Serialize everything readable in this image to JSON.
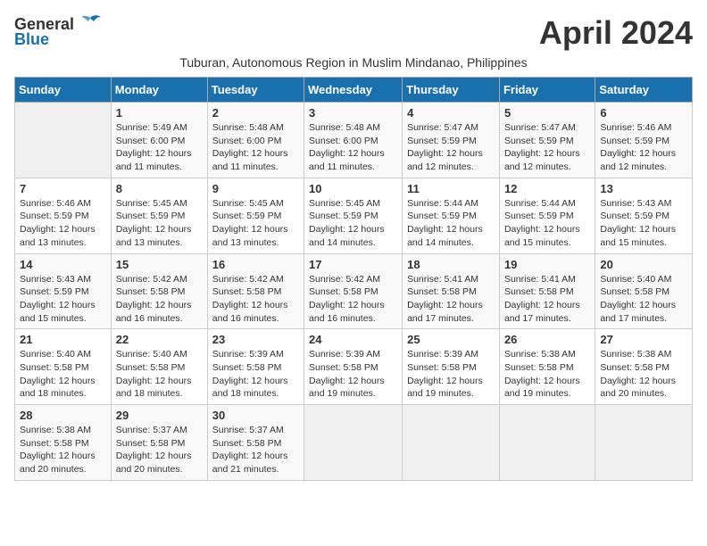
{
  "header": {
    "logo_general": "General",
    "logo_blue": "Blue",
    "title": "April 2024",
    "subtitle": "Tuburan, Autonomous Region in Muslim Mindanao, Philippines"
  },
  "columns": [
    "Sunday",
    "Monday",
    "Tuesday",
    "Wednesday",
    "Thursday",
    "Friday",
    "Saturday"
  ],
  "weeks": [
    [
      {
        "day": "",
        "info": ""
      },
      {
        "day": "1",
        "info": "Sunrise: 5:49 AM\nSunset: 6:00 PM\nDaylight: 12 hours\nand 11 minutes."
      },
      {
        "day": "2",
        "info": "Sunrise: 5:48 AM\nSunset: 6:00 PM\nDaylight: 12 hours\nand 11 minutes."
      },
      {
        "day": "3",
        "info": "Sunrise: 5:48 AM\nSunset: 6:00 PM\nDaylight: 12 hours\nand 11 minutes."
      },
      {
        "day": "4",
        "info": "Sunrise: 5:47 AM\nSunset: 5:59 PM\nDaylight: 12 hours\nand 12 minutes."
      },
      {
        "day": "5",
        "info": "Sunrise: 5:47 AM\nSunset: 5:59 PM\nDaylight: 12 hours\nand 12 minutes."
      },
      {
        "day": "6",
        "info": "Sunrise: 5:46 AM\nSunset: 5:59 PM\nDaylight: 12 hours\nand 12 minutes."
      }
    ],
    [
      {
        "day": "7",
        "info": "Sunrise: 5:46 AM\nSunset: 5:59 PM\nDaylight: 12 hours\nand 13 minutes."
      },
      {
        "day": "8",
        "info": "Sunrise: 5:45 AM\nSunset: 5:59 PM\nDaylight: 12 hours\nand 13 minutes."
      },
      {
        "day": "9",
        "info": "Sunrise: 5:45 AM\nSunset: 5:59 PM\nDaylight: 12 hours\nand 13 minutes."
      },
      {
        "day": "10",
        "info": "Sunrise: 5:45 AM\nSunset: 5:59 PM\nDaylight: 12 hours\nand 14 minutes."
      },
      {
        "day": "11",
        "info": "Sunrise: 5:44 AM\nSunset: 5:59 PM\nDaylight: 12 hours\nand 14 minutes."
      },
      {
        "day": "12",
        "info": "Sunrise: 5:44 AM\nSunset: 5:59 PM\nDaylight: 12 hours\nand 15 minutes."
      },
      {
        "day": "13",
        "info": "Sunrise: 5:43 AM\nSunset: 5:59 PM\nDaylight: 12 hours\nand 15 minutes."
      }
    ],
    [
      {
        "day": "14",
        "info": "Sunrise: 5:43 AM\nSunset: 5:59 PM\nDaylight: 12 hours\nand 15 minutes."
      },
      {
        "day": "15",
        "info": "Sunrise: 5:42 AM\nSunset: 5:58 PM\nDaylight: 12 hours\nand 16 minutes."
      },
      {
        "day": "16",
        "info": "Sunrise: 5:42 AM\nSunset: 5:58 PM\nDaylight: 12 hours\nand 16 minutes."
      },
      {
        "day": "17",
        "info": "Sunrise: 5:42 AM\nSunset: 5:58 PM\nDaylight: 12 hours\nand 16 minutes."
      },
      {
        "day": "18",
        "info": "Sunrise: 5:41 AM\nSunset: 5:58 PM\nDaylight: 12 hours\nand 17 minutes."
      },
      {
        "day": "19",
        "info": "Sunrise: 5:41 AM\nSunset: 5:58 PM\nDaylight: 12 hours\nand 17 minutes."
      },
      {
        "day": "20",
        "info": "Sunrise: 5:40 AM\nSunset: 5:58 PM\nDaylight: 12 hours\nand 17 minutes."
      }
    ],
    [
      {
        "day": "21",
        "info": "Sunrise: 5:40 AM\nSunset: 5:58 PM\nDaylight: 12 hours\nand 18 minutes."
      },
      {
        "day": "22",
        "info": "Sunrise: 5:40 AM\nSunset: 5:58 PM\nDaylight: 12 hours\nand 18 minutes."
      },
      {
        "day": "23",
        "info": "Sunrise: 5:39 AM\nSunset: 5:58 PM\nDaylight: 12 hours\nand 18 minutes."
      },
      {
        "day": "24",
        "info": "Sunrise: 5:39 AM\nSunset: 5:58 PM\nDaylight: 12 hours\nand 19 minutes."
      },
      {
        "day": "25",
        "info": "Sunrise: 5:39 AM\nSunset: 5:58 PM\nDaylight: 12 hours\nand 19 minutes."
      },
      {
        "day": "26",
        "info": "Sunrise: 5:38 AM\nSunset: 5:58 PM\nDaylight: 12 hours\nand 19 minutes."
      },
      {
        "day": "27",
        "info": "Sunrise: 5:38 AM\nSunset: 5:58 PM\nDaylight: 12 hours\nand 20 minutes."
      }
    ],
    [
      {
        "day": "28",
        "info": "Sunrise: 5:38 AM\nSunset: 5:58 PM\nDaylight: 12 hours\nand 20 minutes."
      },
      {
        "day": "29",
        "info": "Sunrise: 5:37 AM\nSunset: 5:58 PM\nDaylight: 12 hours\nand 20 minutes."
      },
      {
        "day": "30",
        "info": "Sunrise: 5:37 AM\nSunset: 5:58 PM\nDaylight: 12 hours\nand 21 minutes."
      },
      {
        "day": "",
        "info": ""
      },
      {
        "day": "",
        "info": ""
      },
      {
        "day": "",
        "info": ""
      },
      {
        "day": "",
        "info": ""
      }
    ]
  ]
}
